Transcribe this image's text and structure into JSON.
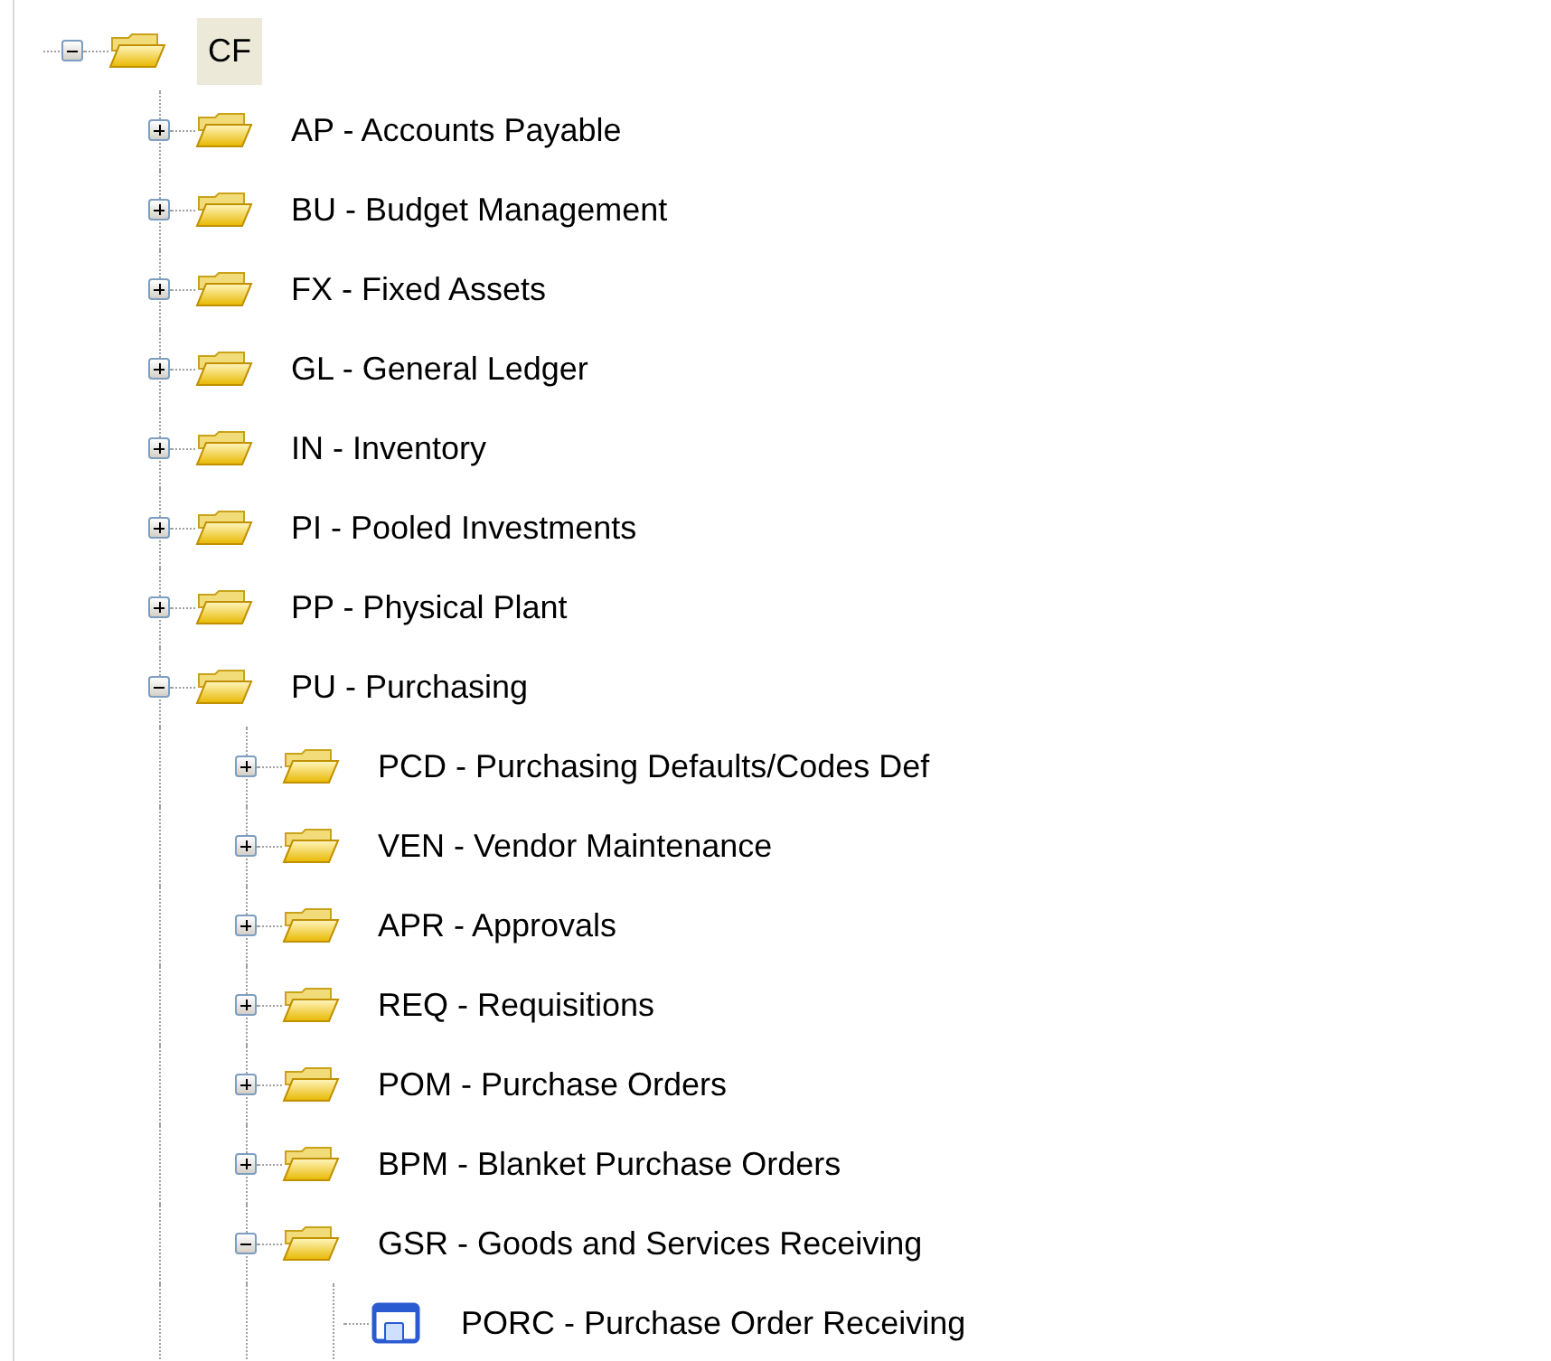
{
  "tree": [
    {
      "label": "CF",
      "kind": "folder",
      "expanded": true,
      "selected": true,
      "children": [
        {
          "label": "AP - Accounts Payable",
          "kind": "folder",
          "expanded": false,
          "selected": false
        },
        {
          "label": "BU - Budget Management",
          "kind": "folder",
          "expanded": false,
          "selected": false
        },
        {
          "label": "FX - Fixed Assets",
          "kind": "folder",
          "expanded": false,
          "selected": false
        },
        {
          "label": "GL - General Ledger",
          "kind": "folder",
          "expanded": false,
          "selected": false
        },
        {
          "label": "IN - Inventory",
          "kind": "folder",
          "expanded": false,
          "selected": false
        },
        {
          "label": "PI - Pooled Investments",
          "kind": "folder",
          "expanded": false,
          "selected": false
        },
        {
          "label": "PP - Physical Plant",
          "kind": "folder",
          "expanded": false,
          "selected": false
        },
        {
          "label": "PU - Purchasing",
          "kind": "folder",
          "expanded": true,
          "selected": false,
          "children": [
            {
              "label": "PCD - Purchasing Defaults/Codes Def",
              "kind": "folder",
              "expanded": false,
              "selected": false
            },
            {
              "label": "VEN - Vendor Maintenance",
              "kind": "folder",
              "expanded": false,
              "selected": false
            },
            {
              "label": "APR - Approvals",
              "kind": "folder",
              "expanded": false,
              "selected": false
            },
            {
              "label": "REQ - Requisitions",
              "kind": "folder",
              "expanded": false,
              "selected": false
            },
            {
              "label": "POM - Purchase Orders",
              "kind": "folder",
              "expanded": false,
              "selected": false
            },
            {
              "label": "BPM - Blanket Purchase Orders",
              "kind": "folder",
              "expanded": false,
              "selected": false
            },
            {
              "label": "GSR - Goods and Services Receiving",
              "kind": "folder",
              "expanded": true,
              "selected": false,
              "children": [
                {
                  "label": "PORC - Purchase Order Receiving",
                  "kind": "form",
                  "selected": false
                }
              ]
            }
          ]
        }
      ]
    }
  ]
}
